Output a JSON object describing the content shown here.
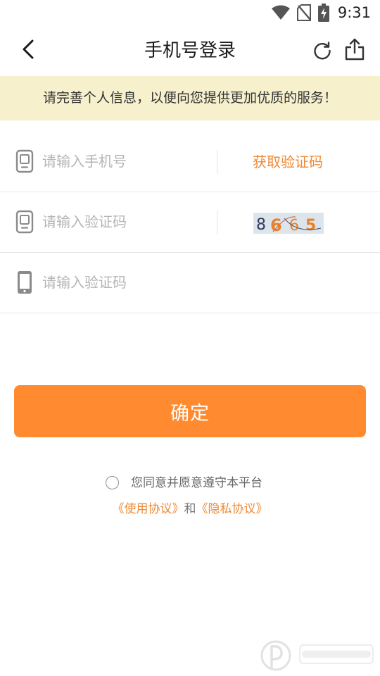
{
  "status_bar": {
    "time": "9:31"
  },
  "nav": {
    "title": "手机号登录"
  },
  "notice": {
    "text": "请完善个人信息，以便向您提供更加优质的服务！"
  },
  "form": {
    "phone": {
      "value": "",
      "placeholder": "请输入手机号"
    },
    "get_code_label": "获取验证码",
    "captcha": {
      "value": "",
      "placeholder": "请输入验证码",
      "digits": [
        "8",
        "6",
        "6",
        "5"
      ]
    },
    "sms_code": {
      "value": "",
      "placeholder": "请输入验证码"
    }
  },
  "confirm_label": "确定",
  "agreement": {
    "text": "您同意并愿意遵守本平台",
    "terms_link": "《使用协议》",
    "and": "和",
    "privacy_link": "《隐私协议》"
  },
  "colors": {
    "accent": "#ff8a2f",
    "link": "#ef8a34",
    "notice_bg": "#f6f0cd"
  },
  "icons": {
    "back": "chevron-left-icon",
    "refresh": "refresh-icon",
    "share": "share-icon",
    "phone": "phone-icon"
  }
}
